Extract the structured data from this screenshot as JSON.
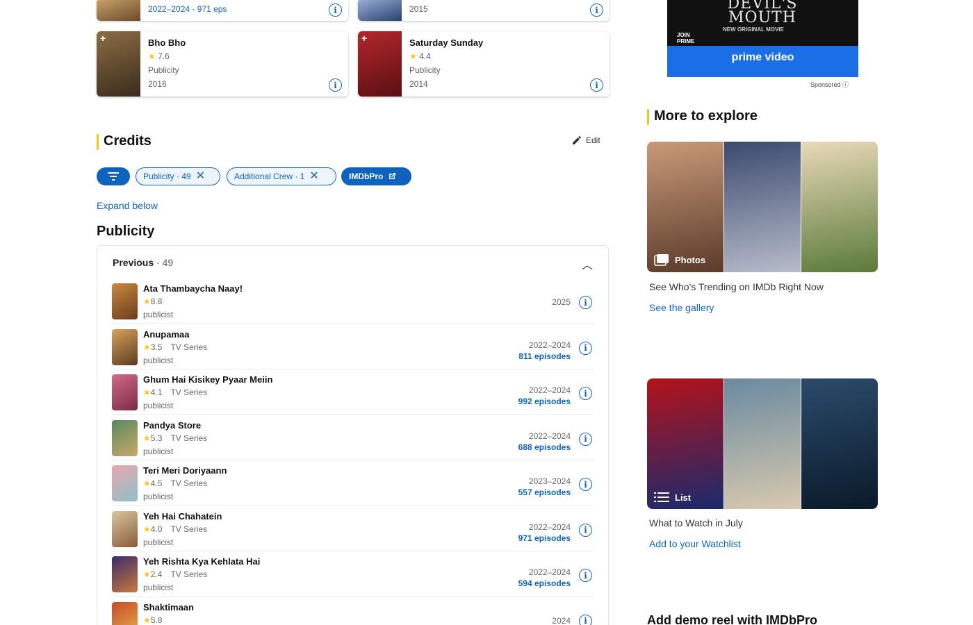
{
  "known_for": [
    {
      "title": "",
      "rating": "",
      "role": "",
      "year": "2022–2024 · 971 eps",
      "partial": true,
      "poster": [
        "#6b4a2a",
        "#c9a46a"
      ]
    },
    {
      "title": "",
      "rating": "",
      "role": "",
      "year": "2015",
      "partial": true,
      "poster": [
        "#2b3f6e",
        "#9ab3d8"
      ]
    },
    {
      "title": "Bho Bho",
      "rating": "7.6",
      "role": "Publicity",
      "year": "2016",
      "partial": false,
      "poster": [
        "#3a2b1c",
        "#8a6d44"
      ]
    },
    {
      "title": "Saturday Sunday",
      "rating": "4.4",
      "role": "Publicity",
      "year": "2014",
      "partial": false,
      "poster": [
        "#5a0f12",
        "#b3262c"
      ]
    }
  ],
  "credits": {
    "title": "Credits",
    "edit_label": "Edit",
    "chips": [
      {
        "label": "Publicity · 49"
      },
      {
        "label": "Additional Crew · 1"
      },
      {
        "label": "IMDbPro"
      }
    ],
    "expand_label": "Expand below"
  },
  "publicity": {
    "heading": "Publicity",
    "previous_label": "Previous",
    "previous_count": "49",
    "rows": [
      {
        "title": "Ata Thambaycha Naay!",
        "rating": "8.8",
        "type": "",
        "role": "publicist",
        "years": "2025",
        "episodes": "",
        "thumb": [
          "#c98a3b",
          "#6b3b1e"
        ]
      },
      {
        "title": "Anupamaa",
        "rating": "3.5",
        "type": "TV Series",
        "role": "publicist",
        "years": "2022–2024",
        "episodes": "811 episodes",
        "thumb": [
          "#d8a35c",
          "#5a3a20"
        ]
      },
      {
        "title": "Ghum Hai Kisikey Pyaar Meiin",
        "rating": "4.1",
        "type": "TV Series",
        "role": "publicist",
        "years": "2022–2024",
        "episodes": "992 episodes",
        "thumb": [
          "#d46a8a",
          "#7a2b45"
        ]
      },
      {
        "title": "Pandya Store",
        "rating": "5.3",
        "type": "TV Series",
        "role": "publicist",
        "years": "2022–2024",
        "episodes": "688 episodes",
        "thumb": [
          "#5a8a5e",
          "#c9a86a"
        ]
      },
      {
        "title": "Teri Meri Doriyaann",
        "rating": "4.5",
        "type": "TV Series",
        "role": "publicist",
        "years": "2023–2024",
        "episodes": "557 episodes",
        "thumb": [
          "#e6a9b0",
          "#8ec0c9"
        ]
      },
      {
        "title": "Yeh Hai Chahatein",
        "rating": "4.0",
        "type": "TV Series",
        "role": "publicist",
        "years": "2022–2024",
        "episodes": "971 episodes",
        "thumb": [
          "#d9c7a0",
          "#8a5a3a"
        ]
      },
      {
        "title": "Yeh Rishta Kya Kehlata Hai",
        "rating": "2.4",
        "type": "TV Series",
        "role": "publicist",
        "years": "2022–2024",
        "episodes": "594 episodes",
        "thumb": [
          "#3a2a6e",
          "#c97a3a"
        ]
      },
      {
        "title": "Shaktimaan",
        "rating": "5.8",
        "type": "",
        "role": "",
        "years": "2024",
        "episodes": "",
        "thumb": [
          "#c94a2a",
          "#e3b34a"
        ]
      }
    ]
  },
  "ad": {
    "title": "DEVIL'S MOUTH",
    "subtitle": "NEW ORIGINAL MOVIE",
    "join": "JOIN PRIME",
    "brand": "prime video",
    "sponsored": "Sponsored"
  },
  "explore": {
    "title": "More to explore",
    "cards": [
      {
        "label": "Photos",
        "caption": "See Who's Trending on IMDb Right Now",
        "link": "See the gallery",
        "tiles": [
          [
            "#c99a78",
            "#5a3a2a"
          ],
          [
            "#3a4a6e",
            "#b8bccb"
          ],
          [
            "#e9d9b8",
            "#5a7a3a"
          ]
        ]
      },
      {
        "label": "List",
        "caption": "What to Watch in July",
        "link": "Add to your Watchlist",
        "tiles": [
          [
            "#b3121a",
            "#1a2a6e"
          ],
          [
            "#6a8aa0",
            "#d8c9b0"
          ],
          [
            "#2a4a6a",
            "#0a1a2a"
          ]
        ]
      }
    ]
  },
  "bottom_section": "Add demo reel with IMDbPro",
  "colors": {
    "accent": "#0e63be",
    "imdb_yellow": "#f5c518"
  }
}
